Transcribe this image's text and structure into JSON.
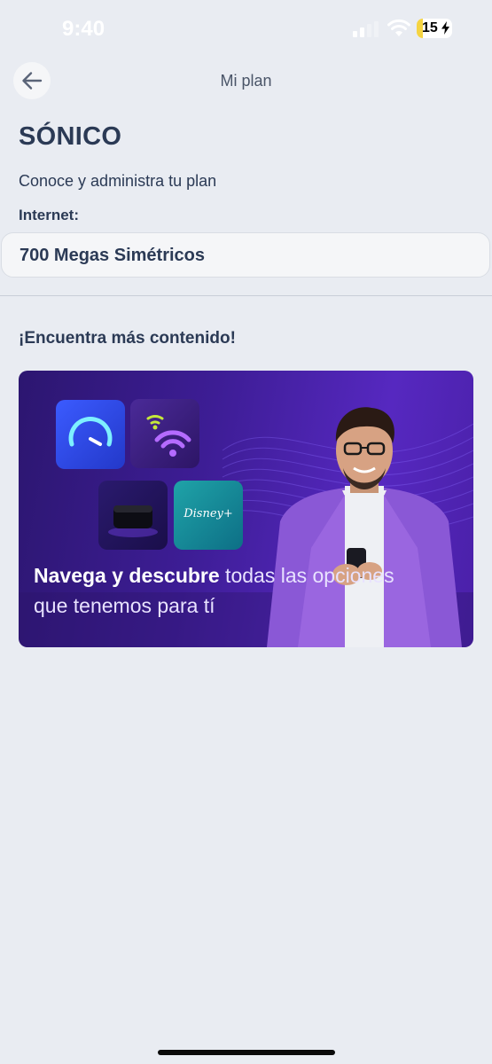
{
  "status_bar": {
    "time": "9:40",
    "battery": "15"
  },
  "nav": {
    "title": "Mi plan"
  },
  "plan": {
    "name": "SÓNICO",
    "subtitle": "Conoce y administra tu plan",
    "internet_label": "Internet:",
    "internet_value": "700 Megas Simétricos"
  },
  "section": {
    "title": "¡Encuentra más contenido!"
  },
  "promo": {
    "bold_text": "Navega y descubre",
    "regular_text": " todas las opciones que tenemos para tí",
    "disney_logo_text": "Disney+"
  },
  "colors": {
    "background": "#e9ecf2",
    "text_primary": "#2b3a55",
    "banner_purple": "#3d1d95"
  }
}
